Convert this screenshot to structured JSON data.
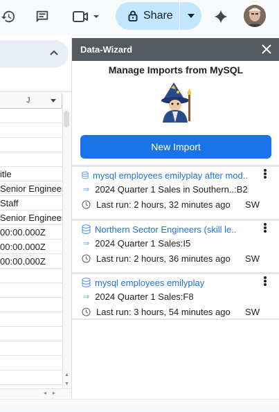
{
  "toolbar": {
    "share_label": "Share"
  },
  "sheet": {
    "column_letter": "J",
    "rows": [
      "",
      "",
      "",
      "",
      "itle",
      "Senior Engineer",
      "Staff",
      "Senior Engineer",
      "00:00.000Z",
      "00:00.000Z",
      "00:00.000Z",
      "",
      "",
      "",
      "",
      "",
      "",
      "",
      ""
    ]
  },
  "panel": {
    "title": "Data-Wizard",
    "heading": "Manage Imports from MySQL",
    "new_import_label": "New Import",
    "imports": [
      {
        "title": "mysql employees emilyplay after mod..",
        "target": "2024 Quarter 1 Sales in Southern..:B2",
        "last_run": "Last run: 2 hours, 32 minutes ago",
        "initials": "SW"
      },
      {
        "title": "Northern Sector Engineers (skill le..",
        "target": "2024 Quarter 1 Sales:I5",
        "last_run": "Last run: 2 hours, 36 minutes ago",
        "initials": "SW"
      },
      {
        "title": "mysql employees emilyplay",
        "target": "2024 Quarter 1 Sales:F8",
        "last_run": "Last run: 3 hours, 54 minutes ago",
        "initials": "SW"
      }
    ]
  },
  "colors": {
    "share_bg": "#c2e7ff",
    "panel_header": "#555a5e",
    "accent": "#1a73e8"
  }
}
